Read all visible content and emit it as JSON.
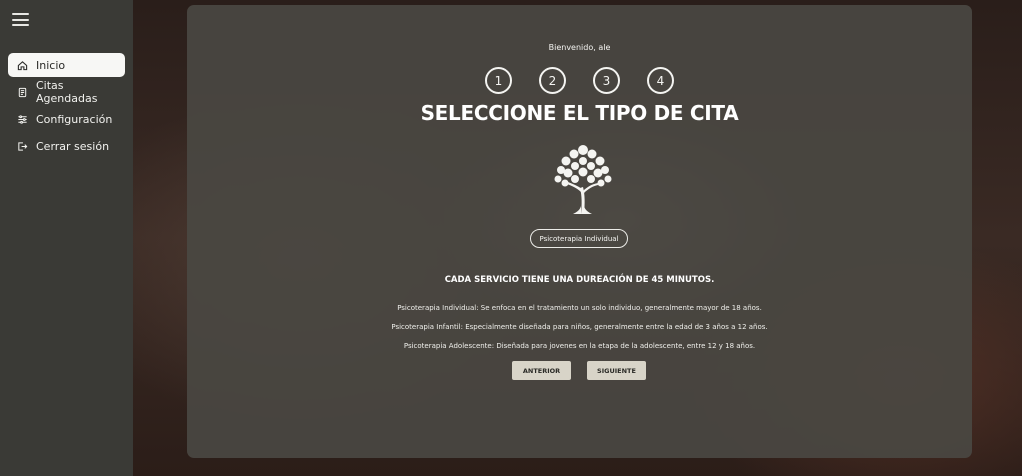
{
  "sidebar": {
    "menu_icon": "hamburger-icon",
    "items": [
      {
        "label": "Inicio",
        "icon": "home-icon",
        "active": true
      },
      {
        "label": "Citas Agendadas",
        "icon": "document-icon",
        "active": false
      },
      {
        "label": "Configuración",
        "icon": "sliders-icon",
        "active": false
      },
      {
        "label": "Cerrar sesión",
        "icon": "logout-icon",
        "active": false
      }
    ]
  },
  "main": {
    "welcome": "Bienvenido, ale",
    "steps": [
      "1",
      "2",
      "3",
      "4"
    ],
    "title": "SELECCIONE EL TIPO DE CITA",
    "logo_icon": "tree-logo-icon",
    "type_button": "Psicoterapia Individual",
    "duration_note": "CADA SERVICIO TIENE UNA DUREACIÓN DE 45 MINUTOS.",
    "descriptions": [
      "Psicoterapia Individual: Se enfoca en el tratamiento un solo individuo, generalmente mayor de 18 años.",
      "Psicoterapia Infantil: Especialmente diseñada para niños, generalmente entre la edad de 3 años a 12 años.",
      "Psicoterapia Adolescente: Diseñada para jovenes en la etapa de la adolescente, entre 12 y 18 años."
    ],
    "prev_button": "ANTERIOR",
    "next_button": "SIGUIENTE"
  },
  "colors": {
    "sidebar": "#3a3a36",
    "panel": "#4a4842",
    "button": "#d8d4c8",
    "text": "#ffffff"
  }
}
